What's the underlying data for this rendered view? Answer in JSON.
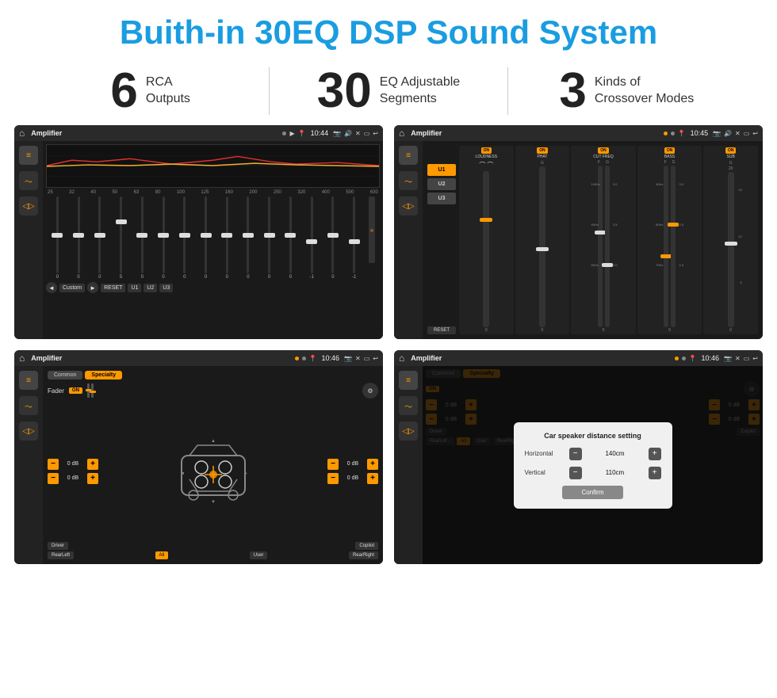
{
  "header": {
    "title": "Buith-in 30EQ DSP Sound System"
  },
  "stats": [
    {
      "number": "6",
      "label_line1": "RCA",
      "label_line2": "Outputs"
    },
    {
      "number": "30",
      "label_line1": "EQ Adjustable",
      "label_line2": "Segments"
    },
    {
      "number": "3",
      "label_line1": "Kinds of",
      "label_line2": "Crossover Modes"
    }
  ],
  "screens": {
    "screen1": {
      "title": "Amplifier",
      "time": "10:44",
      "type": "eq",
      "freq_labels": [
        "25",
        "32",
        "40",
        "50",
        "63",
        "80",
        "100",
        "125",
        "160",
        "200",
        "250",
        "320",
        "400",
        "500",
        "630"
      ],
      "slider_values": [
        "0",
        "0",
        "0",
        "5",
        "0",
        "0",
        "0",
        "0",
        "0",
        "0",
        "0",
        "0",
        "-1",
        "0",
        "-1"
      ],
      "eq_preset": "Custom",
      "buttons": [
        "◄",
        "Custom",
        "►",
        "RESET",
        "U1",
        "U2",
        "U3"
      ]
    },
    "screen2": {
      "title": "Amplifier",
      "time": "10:45",
      "type": "crossover",
      "presets": [
        "U1",
        "U2",
        "U3"
      ],
      "channels": [
        "LOUDNESS",
        "PHAT",
        "CUT FREQ",
        "BASS",
        "SUB"
      ],
      "reset_label": "RESET"
    },
    "screen3": {
      "title": "Amplifier",
      "time": "10:46",
      "type": "fader",
      "tabs": [
        "Common",
        "Specialty"
      ],
      "active_tab": "Specialty",
      "fader_label": "Fader",
      "fader_on": "ON",
      "db_values": [
        "0 dB",
        "0 dB",
        "0 dB",
        "0 dB"
      ],
      "bottom_buttons": [
        "Driver",
        "",
        "Copilot",
        "RearLeft",
        "All",
        "User",
        "RearRight"
      ]
    },
    "screen4": {
      "title": "Amplifier",
      "time": "10:46",
      "type": "fader_dialog",
      "tabs": [
        "Common",
        "Specialty"
      ],
      "active_tab": "Specialty",
      "dialog": {
        "title": "Car speaker distance setting",
        "horizontal_label": "Horizontal",
        "horizontal_value": "140cm",
        "vertical_label": "Vertical",
        "vertical_value": "110cm",
        "confirm_label": "Confirm"
      },
      "db_values": [
        "0 dB",
        "0 dB"
      ],
      "bottom_buttons": [
        "Driver",
        "Copilot",
        "RearLef...",
        "User",
        "RearRight"
      ]
    }
  }
}
